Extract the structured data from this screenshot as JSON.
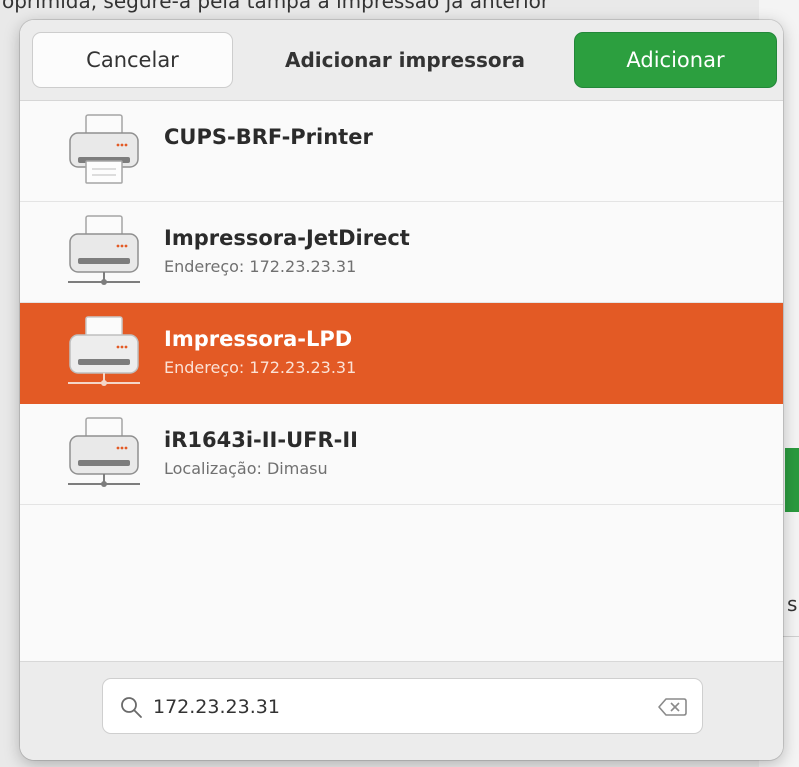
{
  "background": {
    "top_text": "oprimida, segure-a pela tampa a impressão já anterior",
    "side_text": "s"
  },
  "colors": {
    "accent_selected": "#E35A25",
    "primary_button": "#2C9F3F"
  },
  "dialog": {
    "header": {
      "cancel_label": "Cancelar",
      "title": "Adicionar impressora",
      "add_label": "Adicionar"
    },
    "printers": [
      {
        "name": "CUPS-BRF-Printer",
        "detail": "",
        "icon": "printer-icon",
        "selected": false
      },
      {
        "name": "Impressora-JetDirect",
        "detail": "Endereço: 172.23.23.31",
        "icon": "network-printer-icon",
        "selected": false
      },
      {
        "name": "Impressora-LPD",
        "detail": "Endereço: 172.23.23.31",
        "icon": "network-printer-icon",
        "selected": true
      },
      {
        "name": "iR1643i-II-UFR-II",
        "detail": "Localização: Dimasu",
        "icon": "network-printer-icon",
        "selected": false
      }
    ],
    "search": {
      "value": "172.23.23.31",
      "placeholder": ""
    }
  }
}
